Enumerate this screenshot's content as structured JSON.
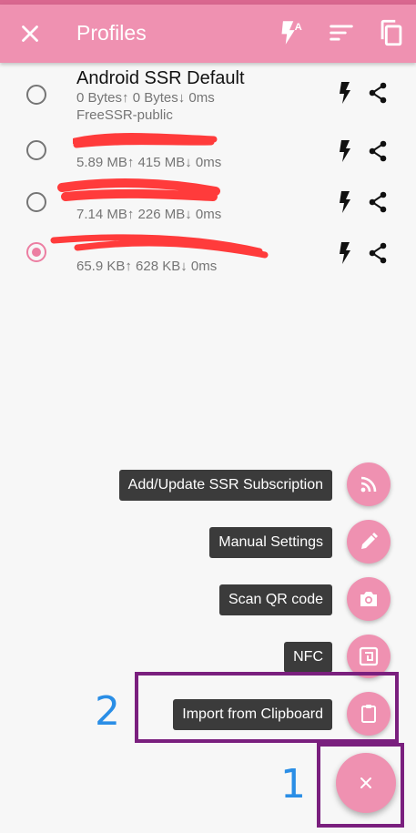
{
  "appbar": {
    "title": "Profiles",
    "close_icon": "close-icon",
    "actions": [
      "flash-auto-icon",
      "sort-icon",
      "copy-icon"
    ]
  },
  "profiles": [
    {
      "name": "Android SSR Default",
      "stats": "0 Bytes↑ 0 Bytes↓ 0ms",
      "group": "FreeSSR-public",
      "selected": false
    },
    {
      "name": "",
      "stats": "5.89 MB↑ 415 MB↓ 0ms",
      "group": "",
      "selected": false
    },
    {
      "name": "",
      "stats": "7.14 MB↑ 226 MB↓ 0ms",
      "group": "",
      "selected": false
    },
    {
      "name": "",
      "stats": "65.9 KB↑ 628 KB↓ 0ms",
      "group": "",
      "selected": true
    }
  ],
  "fab_menu": [
    {
      "label": "Add/Update SSR Subscription",
      "icon": "rss-icon"
    },
    {
      "label": "Manual Settings",
      "icon": "pencil-icon"
    },
    {
      "label": "Scan QR code",
      "icon": "camera-icon"
    },
    {
      "label": "NFC",
      "icon": "nfc-icon"
    },
    {
      "label": "Import from Clipboard",
      "icon": "clipboard-icon"
    }
  ],
  "main_fab_icon": "close-icon",
  "annotations": {
    "step1": "1",
    "step2": "2"
  },
  "colors": {
    "accent": "#ef91b1",
    "accent_dark": "#d9678f",
    "annotation_box": "#7a1f7e",
    "annotation_number": "#2a8ee6",
    "scribble": "#ff3b3b"
  }
}
